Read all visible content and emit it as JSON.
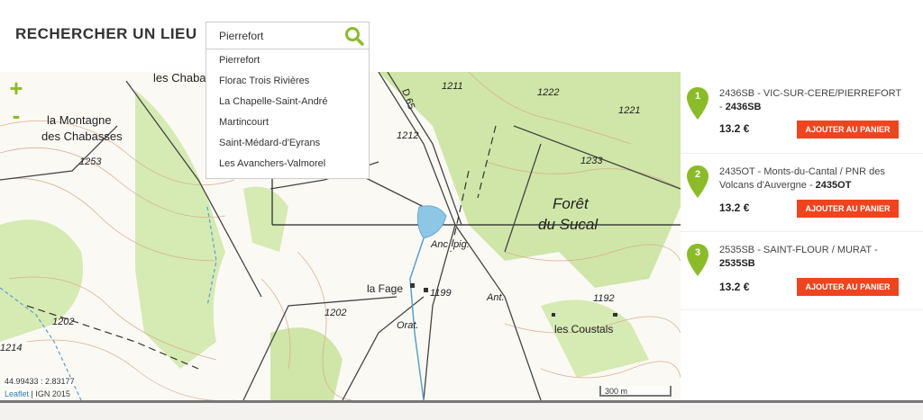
{
  "header": {
    "title": "RECHERCHER UN LIEU"
  },
  "search": {
    "value": "Pierrefort",
    "icon": "search-icon"
  },
  "dropdown": {
    "items": [
      "Pierrefort",
      "Florac Trois Rivières",
      "La Chapelle-Saint-André",
      "Martincourt",
      "Saint-Médard-d'Eyrans",
      "Les Avanchers-Valmorel"
    ]
  },
  "map": {
    "zoom_in": "+",
    "zoom_out": "-",
    "coords": "44.99433 : 2.83177",
    "attribution": {
      "leaflet": "Leaflet",
      "separator": " | ",
      "source": "IGN 2015"
    },
    "scale": "300 m",
    "labels": {
      "chabasses_top": "les Chabas",
      "montagne_1": "la Montagne",
      "montagne_2": "des Chabasses",
      "h1253": "1253",
      "d65": "D 65",
      "h1211": "1211",
      "h1222": "1222",
      "h1221": "1221",
      "h1212": "1212",
      "h1233": "1233",
      "foret": "Forêt",
      "sucal": "du Sucal",
      "anc_pig": "Anc. pig.",
      "la_fage": "la Fage",
      "h1199": "1199",
      "ant": "Ant.",
      "h1192": "1192",
      "h1202a": "1202",
      "h1202b": "1202",
      "h1214": "1214",
      "orat": "Orat.",
      "coustals": "les Coustals"
    }
  },
  "results": [
    {
      "number": "1",
      "title": "2436SB - VIC-SUR-CERE/PIERREFORT - ",
      "code": "2436SB",
      "price": "13.2 €",
      "button": "AJOUTER AU PANIER"
    },
    {
      "number": "2",
      "title": "2435OT - Monts-du-Cantal / PNR des Volcans d'Auvergne - ",
      "code": "2435OT",
      "price": "13.2 €",
      "button": "AJOUTER AU PANIER"
    },
    {
      "number": "3",
      "title": "2535SB - SAINT-FLOUR / MURAT - ",
      "code": "2535SB",
      "price": "13.2 €",
      "button": "AJOUTER AU PANIER"
    }
  ],
  "colors": {
    "accent": "#8cbb2a",
    "button": "#f0441f",
    "forest": "#cfe6a8",
    "water": "#8ec6e6",
    "contour": "#d9a98a"
  }
}
